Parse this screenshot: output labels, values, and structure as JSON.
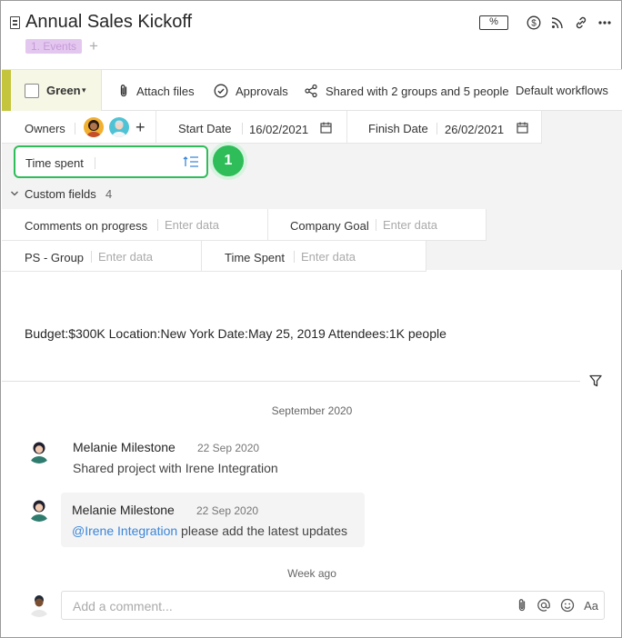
{
  "header": {
    "title": "Annual Sales Kickoff",
    "percent_label": "%",
    "tag": "1. Events",
    "tag_add": "+"
  },
  "action_bar": {
    "status_label": "Green",
    "status_caret": "▾",
    "status_color": "#c4c43d",
    "attach_label": "Attach files",
    "approvals_label": "Approvals",
    "shared_label": "Shared with 2 groups and 5 people",
    "workflows_label": "Default workflows"
  },
  "fields": {
    "owners_label": "Owners",
    "owners_add": "+",
    "start_date_label": "Start Date",
    "start_date_value": "16/02/2021",
    "finish_date_label": "Finish Date",
    "finish_date_value": "26/02/2021",
    "time_spent_label": "Time spent",
    "step_badge": "1",
    "custom_fields_label": "Custom fields",
    "custom_fields_count": "4",
    "custom": [
      {
        "label": "Comments on progress",
        "placeholder": "Enter data"
      },
      {
        "label": "Company Goal",
        "placeholder": "Enter data"
      },
      {
        "label": "PS - Group",
        "placeholder": "Enter data"
      },
      {
        "label": "Time Spent",
        "placeholder": "Enter data"
      }
    ]
  },
  "description": "Budget:$300K Location:New York Date:May 25, 2019 Attendees:1K people",
  "activity": {
    "month": "September 2020",
    "entries": [
      {
        "author": "Melanie Milestone",
        "date": "22 Sep 2020",
        "text": "Shared project with Irene Integration"
      },
      {
        "author": "Melanie Milestone",
        "date": "22 Sep 2020",
        "mention": "@Irene Integration",
        "text": " please add the latest updates"
      }
    ],
    "week_label": "Week ago"
  },
  "comment_input": {
    "placeholder": "Add a comment...",
    "format_label": "Aa"
  },
  "colors": {
    "accent_green": "#2ebd59",
    "tag_bg": "#e4c7ef",
    "mention": "#3b86d8"
  }
}
